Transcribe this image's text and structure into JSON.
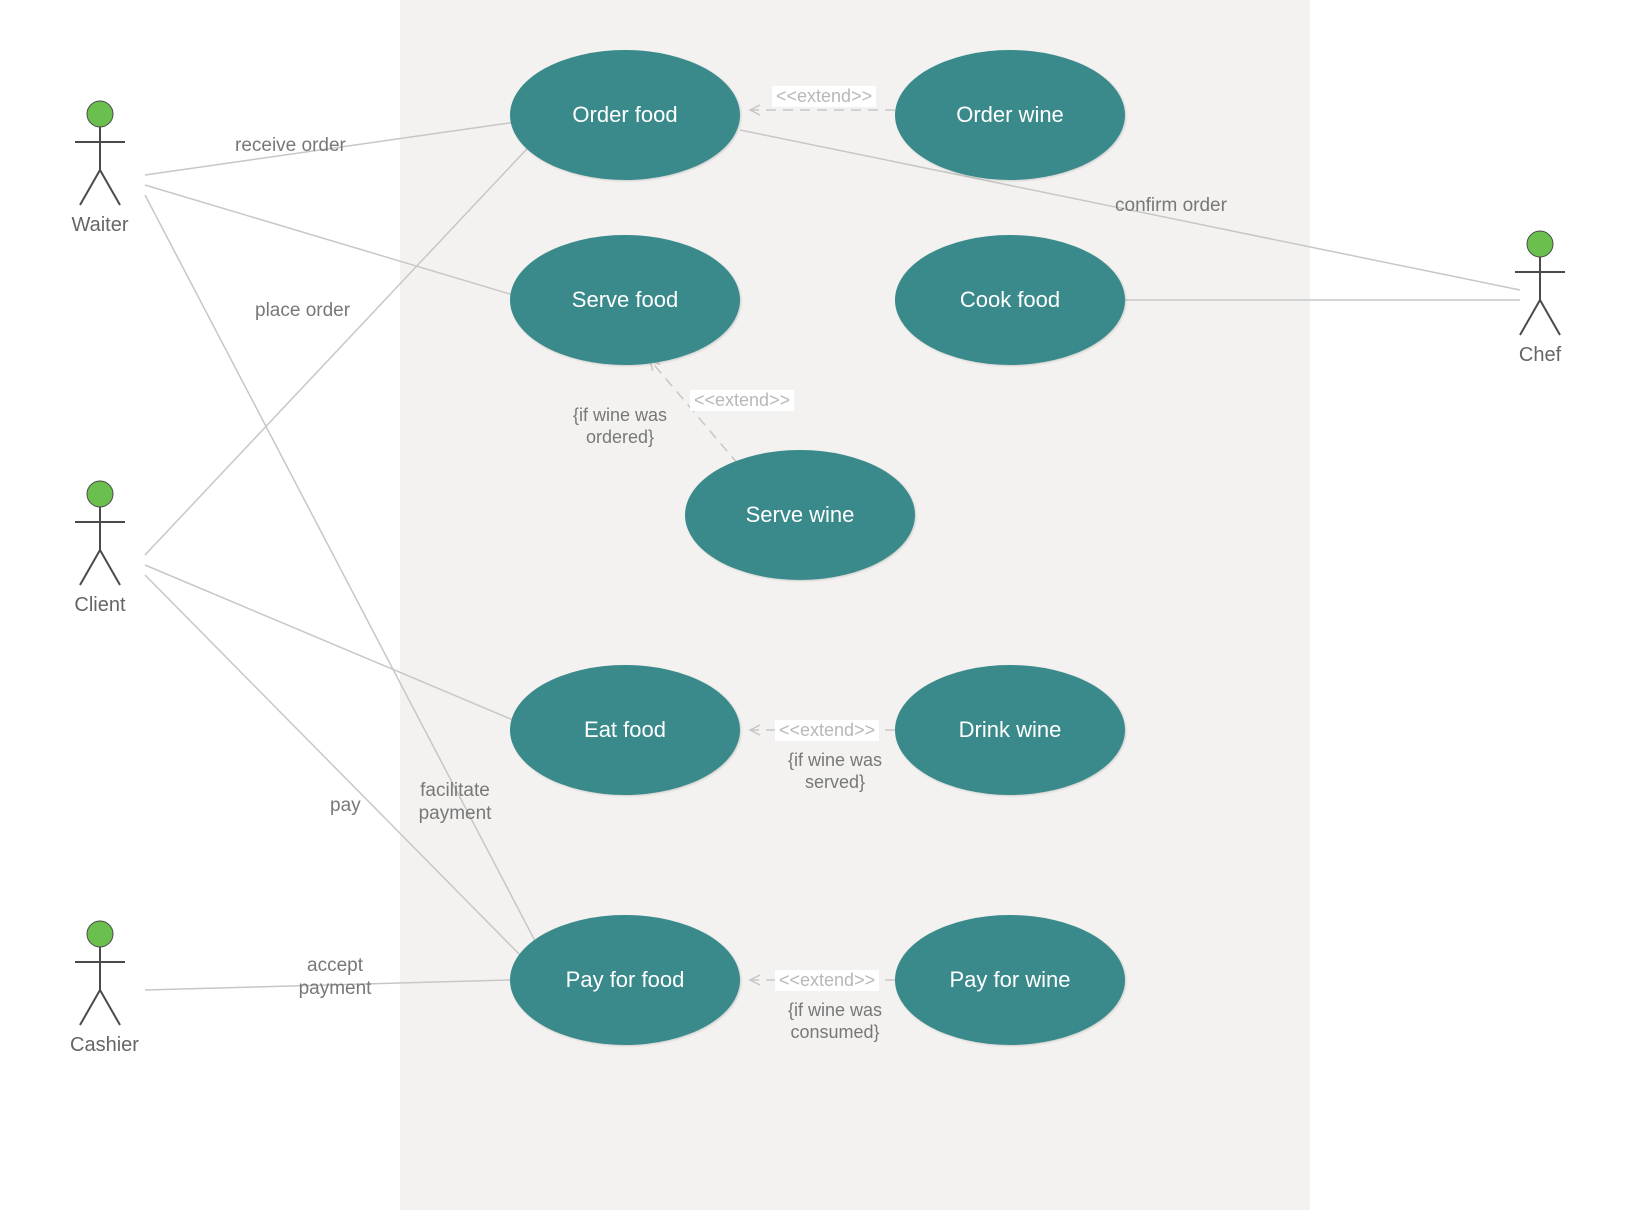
{
  "actors": {
    "waiter": "Waiter",
    "client": "Client",
    "cashier": "Cashier",
    "chef": "Chef"
  },
  "usecases": {
    "order_food": "Order food",
    "order_wine": "Order wine",
    "serve_food": "Serve food",
    "cook_food": "Cook food",
    "serve_wine": "Serve wine",
    "eat_food": "Eat food",
    "drink_wine": "Drink wine",
    "pay_for_food": "Pay for food",
    "pay_for_wine": "Pay for wine"
  },
  "relations": {
    "receive_order": "receive order",
    "place_order": "place order",
    "confirm_order": "confirm order",
    "pay": "pay",
    "facilitate_payment": "facilitate payment",
    "accept_payment": "accept payment"
  },
  "extends": {
    "label": "<<extend>>"
  },
  "constraints": {
    "wine_ordered": "{if wine was ordered}",
    "wine_served": "{if wine was served}",
    "wine_consumed": "{if wine was consumed}"
  },
  "colors": {
    "usecase_fill": "#3a8a8c",
    "actor_head": "#6bbf4f",
    "line": "#c7c7c7",
    "boundary": "#f3f2f0"
  }
}
